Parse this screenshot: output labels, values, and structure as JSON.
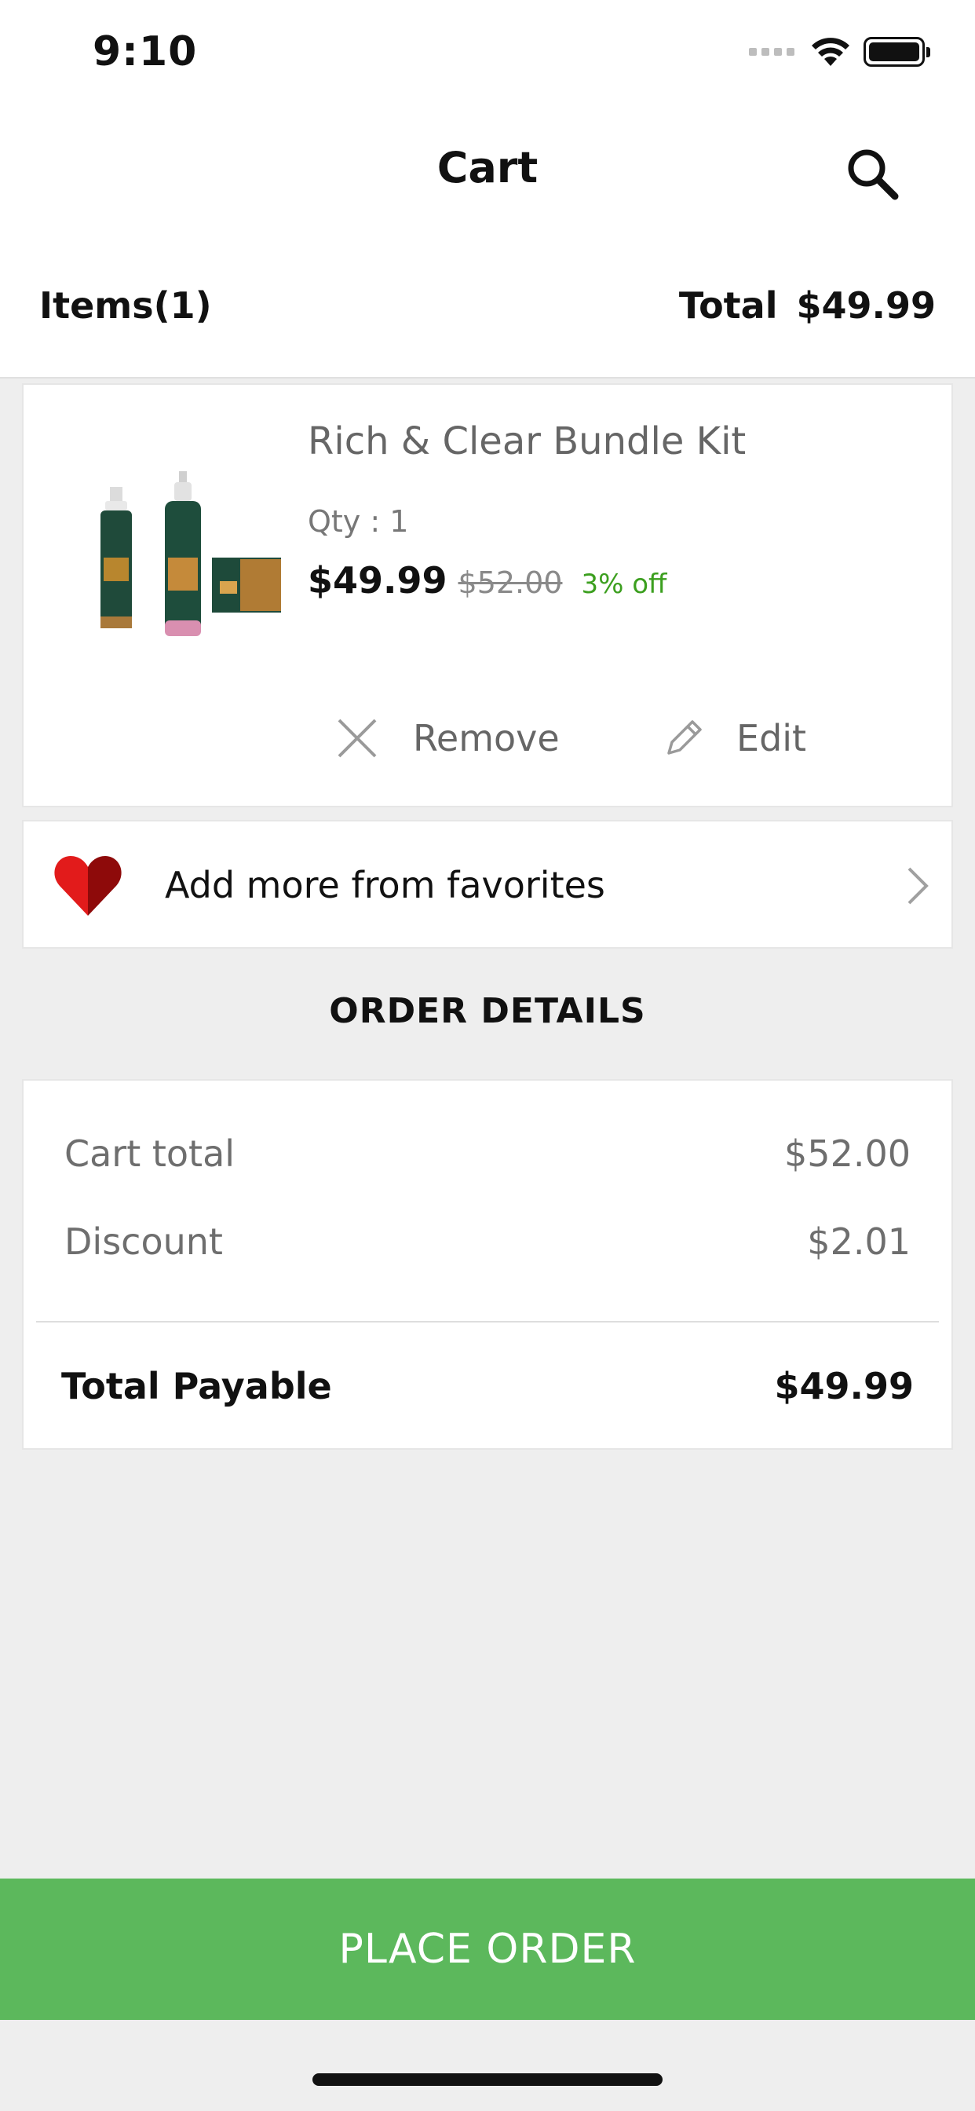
{
  "status_bar": {
    "time": "9:10"
  },
  "nav": {
    "title": "Cart",
    "search_icon": "search-icon"
  },
  "summary": {
    "items_label": "Items(1)",
    "total_label": "Total",
    "total_value": "$49.99"
  },
  "cart_items": [
    {
      "name": "Rich & Clear Bundle Kit",
      "qty": "Qty : 1",
      "price": "$49.99",
      "original_price": "$52.00",
      "discount": "3% off",
      "remove_label": "Remove",
      "edit_label": "Edit"
    }
  ],
  "favorites": {
    "label": "Add more from favorites",
    "icon": "heart-icon"
  },
  "order_details": {
    "heading": "ORDER DETAILS",
    "cart_total_label": "Cart total",
    "cart_total_value": "$52.00",
    "discount_label": "Discount",
    "discount_value": "$2.01",
    "total_payable_label": "Total Payable",
    "total_payable_value": "$49.99"
  },
  "place_order": {
    "label": "PLACE ORDER"
  },
  "colors": {
    "accent_green": "#5cb85c",
    "discount_green": "#3c9f1f",
    "heart_red": "#e21b1b",
    "heart_dark_red": "#8e0a0a",
    "background": "#eeeeee"
  }
}
